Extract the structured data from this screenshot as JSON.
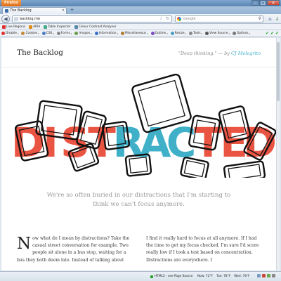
{
  "browser": {
    "app_button": "Firefox",
    "tab_title": "The Backlog",
    "url": "backlog.me",
    "search_placeholder": "Google",
    "window_controls": [
      "–",
      "□",
      "✕"
    ]
  },
  "bookmarks": [
    {
      "label": "Live Regions",
      "color": "#d33"
    },
    {
      "label": "ARIA",
      "color": "#e08a12"
    },
    {
      "label": "Table Inspector",
      "color": "#4a8"
    },
    {
      "label": "Colour Contrast Analyser",
      "color": "#58a"
    }
  ],
  "dev_toolbar": [
    {
      "label": "Disable",
      "color": "#d33"
    },
    {
      "label": "Cookies",
      "color": "#c48a3a"
    },
    {
      "label": "CSS",
      "color": "#4a7bc4"
    },
    {
      "label": "Forms",
      "color": "#888"
    },
    {
      "label": "Images",
      "color": "#6a9c4a"
    },
    {
      "label": "Information",
      "color": "#3a6ec4"
    },
    {
      "label": "Miscellaneous",
      "color": "#b07a2a"
    },
    {
      "label": "Outline",
      "color": "#7a4ac4"
    },
    {
      "label": "Resize",
      "color": "#4a9cc4"
    },
    {
      "label": "Tools",
      "color": "#888"
    },
    {
      "label": "View Source",
      "color": "#555"
    },
    {
      "label": "Options",
      "color": "#777"
    }
  ],
  "site": {
    "title": "The Backlog",
    "tagline": "\"Deep thinking.\" — by",
    "author": "CJ Melegrito",
    "hero_word": "DISTRACTED",
    "hero_letters": [
      "D",
      "I",
      "S",
      "T",
      "R",
      "A",
      "C",
      "T",
      "E",
      "D"
    ],
    "intro": "We're so often buried in our distractions that I'm starting to think we can't focus anymore.",
    "dropcap": "N",
    "col1": "ow what do I mean by distractions? Take the casual street conversation for example. Two people sit alone in a bus stop, waiting for a bus they both deem late. Instead of talking about",
    "col2": "I find it really hard to focus at all anymore. If I had the time to get my focus checked, I'm sure I'd score really low if I took a test based on concentration. Distractions are everywhere. I"
  },
  "status": {
    "html5": "HTML5 - see Page Source",
    "weather_now": "Now: 72°F",
    "weather_tue": "Tue: 78°F",
    "weather_wed": "Wed: 78°F"
  },
  "colors": {
    "accent": "#3fb0c8",
    "hero_red": "#ea5443",
    "hero_blue": "#3fb0c8"
  }
}
